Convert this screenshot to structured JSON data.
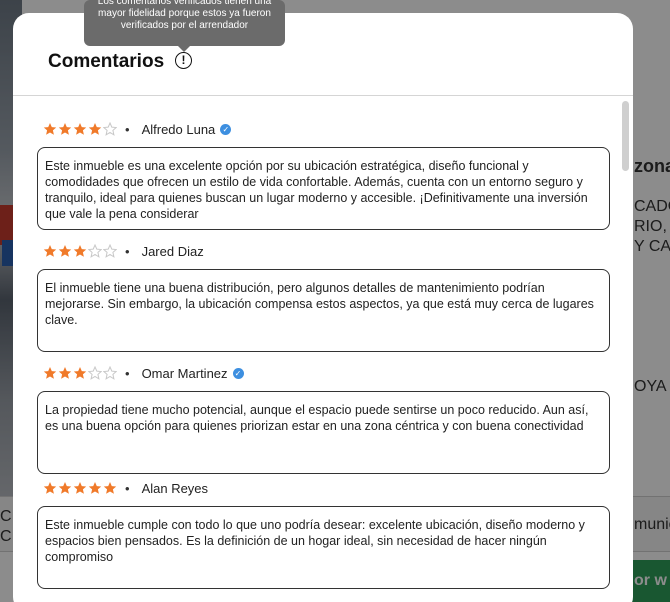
{
  "background": {
    "right_texts": [
      "zona",
      "CADO",
      "RIO,",
      "Y CA",
      "OYA",
      "munic",
      "or w"
    ],
    "left_texts": [
      "C",
      "C"
    ]
  },
  "modal": {
    "title": "Comentarios",
    "info_icon_glyph": "!",
    "tooltip": "Los comentarios verificados tienen una mayor fidelidad porque estos ya fueron verificados por el arrendador"
  },
  "colors": {
    "star_filled": "#f07a2a",
    "star_empty": "#c8c8c8",
    "verified_badge": "#3d8fe0"
  },
  "reviews": [
    {
      "rating": 4,
      "author": "Alfredo Luna",
      "verified": true,
      "text": "Este inmueble es una excelente opción por su ubicación estratégica, diseño funcional y comodidades que ofrecen un estilo de vida confortable. Además, cuenta con un entorno seguro y tranquilo, ideal para quienes buscan un lugar moderno y accesible. ¡Definitivamente una inversión que vale la pena considerar"
    },
    {
      "rating": 3,
      "author": "Jared Diaz",
      "verified": false,
      "text": "El inmueble tiene una buena distribución, pero algunos detalles de mantenimiento podrían mejorarse. Sin embargo, la ubicación compensa estos aspectos, ya que está muy cerca de lugares clave."
    },
    {
      "rating": 3,
      "author": "Omar Martinez",
      "verified": true,
      "text": "La propiedad tiene mucho potencial, aunque el espacio puede sentirse un poco reducido. Aun así, es una buena opción para quienes priorizan estar en una zona céntrica y con buena conectividad"
    },
    {
      "rating": 5,
      "author": "Alan Reyes",
      "verified": false,
      "text": "Este inmueble cumple con todo lo que uno podría desear: excelente ubicación, diseño moderno y espacios bien pensados. Es la definición de un hogar ideal, sin necesidad de hacer ningún compromiso"
    }
  ]
}
